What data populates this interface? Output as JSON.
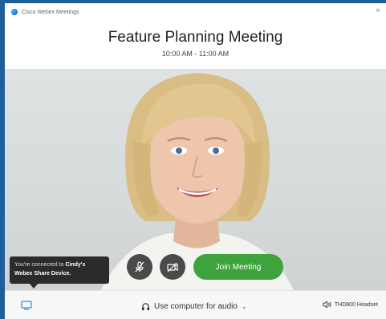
{
  "window": {
    "app_title": "Cisco Webex Meetings",
    "close_glyph": "×"
  },
  "meeting": {
    "title": "Feature Planning Meeting",
    "time": "10:00 AM - 11:00 AM"
  },
  "tooltip": {
    "prefix": "You're connected to ",
    "device": "Cindy's Webex Share Device."
  },
  "controls": {
    "join_label": "Join Meeting",
    "mute_icon": "microphone-muted-icon",
    "video_icon": "video-off-icon"
  },
  "bottom": {
    "audio_label": "Use computer for audio",
    "audio_chevron": "⌄",
    "headset_label": "THD800 Headset",
    "share_icon": "screen-share-icon",
    "speaker_icon": "speaker-icon"
  },
  "colors": {
    "accent_green": "#3ea33c",
    "tooltip_bg": "#2b2b2b",
    "button_dark": "#4a4a4a",
    "desktop_blue": "#1f5f99"
  }
}
